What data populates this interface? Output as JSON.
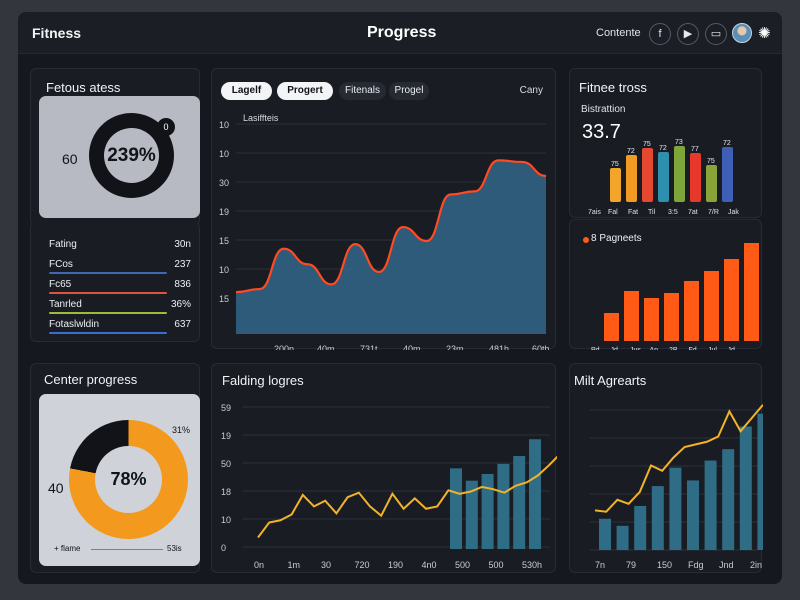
{
  "header": {
    "brand": "Fitness",
    "title": "Progress",
    "link": "Contente",
    "icons": [
      "facebook-icon",
      "play-icon",
      "mail-icon",
      "avatar",
      "gear-sun-icon"
    ]
  },
  "left_top": {
    "title": "Fetous atess",
    "donut_value": "239%",
    "side_value": "60",
    "badge_value": "0",
    "rows": [
      {
        "label": "Fating",
        "value": "30n",
        "color": "#26282f"
      },
      {
        "label": "FCos",
        "value": "237",
        "color": "#3e67b4"
      },
      {
        "label": "Fc65",
        "value": "836",
        "color": "#e0533d"
      },
      {
        "label": "Tanrled",
        "value": "36%",
        "color": "#9cbc3d"
      },
      {
        "label": "Fotaslwldin",
        "value": "637",
        "color": "#3b6ed0"
      }
    ]
  },
  "main_chart": {
    "tabs": [
      "Lagelf",
      "Progert",
      "Fitenals",
      "Progel"
    ],
    "right_label": "Cany",
    "chart_data": {
      "type": "area",
      "title": "Lasiffteis",
      "y_ticks": [
        "10",
        "10",
        "30",
        "19",
        "15",
        "10",
        "15"
      ],
      "x_ticks": [
        "200n",
        "40m",
        "731t",
        "40m",
        "23m",
        "481h",
        "60th"
      ],
      "values": [
        27,
        29,
        55,
        45,
        32,
        58,
        40,
        69,
        60,
        90,
        92,
        112,
        111,
        102
      ]
    }
  },
  "right_top": {
    "title": "Fitnee tross",
    "subtitle": "Bistrattion",
    "value": "33.7",
    "chart_data": {
      "type": "bar",
      "labels": [
        "75",
        "72",
        "75",
        "72",
        "73",
        "77",
        "75",
        "72"
      ],
      "x_ticks": [
        "7ais",
        "Fal",
        "Fat",
        "Til",
        "3:5",
        "7at",
        "7/R",
        "Jak"
      ],
      "values": [
        34,
        47,
        54,
        50,
        56,
        49,
        37,
        55
      ],
      "colors": [
        "#f2a52a",
        "#f39a24",
        "#e5482e",
        "#2f8fae",
        "#7ea63b",
        "#e8382b",
        "#8aa43a",
        "#3f5fb7"
      ]
    }
  },
  "right_middle": {
    "title": "8 Pagneets",
    "chart_data": {
      "type": "bar",
      "x_ticks": [
        "Pd",
        "Jd",
        "Jus",
        "An",
        "2B",
        "Fd",
        "Jul",
        "Jd"
      ],
      "values": [
        28,
        50,
        43,
        48,
        60,
        70,
        82,
        98
      ],
      "color": "#ff5a16"
    }
  },
  "left_bottom": {
    "title": "Center progress",
    "value": "78%",
    "side_value": "40",
    "corner_value": "31%",
    "footer_left": "+ flame",
    "footer_right": "53is"
  },
  "bottom_middle": {
    "title": "Falding logres",
    "chart_data": {
      "type": "line",
      "y_ticks": [
        "59",
        "19",
        "50",
        "18",
        "10",
        "0"
      ],
      "x_ticks": [
        "0n",
        "1m",
        "30",
        "720",
        "190",
        "4n0",
        "500",
        "500",
        "530h"
      ],
      "line_values": [
        10,
        23,
        25,
        30,
        47,
        37,
        42,
        31,
        45,
        49,
        37,
        29,
        48,
        35,
        44,
        35,
        37,
        51,
        48,
        50,
        54,
        52,
        49,
        55,
        58,
        64,
        73,
        83,
        101
      ],
      "bars": [
        72,
        61,
        67,
        76,
        83,
        98
      ],
      "line_color": "#f2b327",
      "bar_color": "#2f6d87"
    }
  },
  "bottom_right": {
    "title": "Milt Agrearts",
    "chart_data": {
      "type": "bar",
      "x_ticks": [
        "7n",
        "79",
        "150",
        "Fdg",
        "Jnd",
        "2in"
      ],
      "line_values": [
        30,
        29,
        38,
        35,
        44,
        64,
        60,
        70,
        78,
        80,
        82,
        86,
        105,
        90,
        100,
        110
      ],
      "bars": [
        22,
        17,
        31,
        45,
        58,
        49,
        63,
        71,
        87,
        96
      ],
      "line_color": "#f2b327",
      "bar_color": "#2f6d87"
    }
  }
}
